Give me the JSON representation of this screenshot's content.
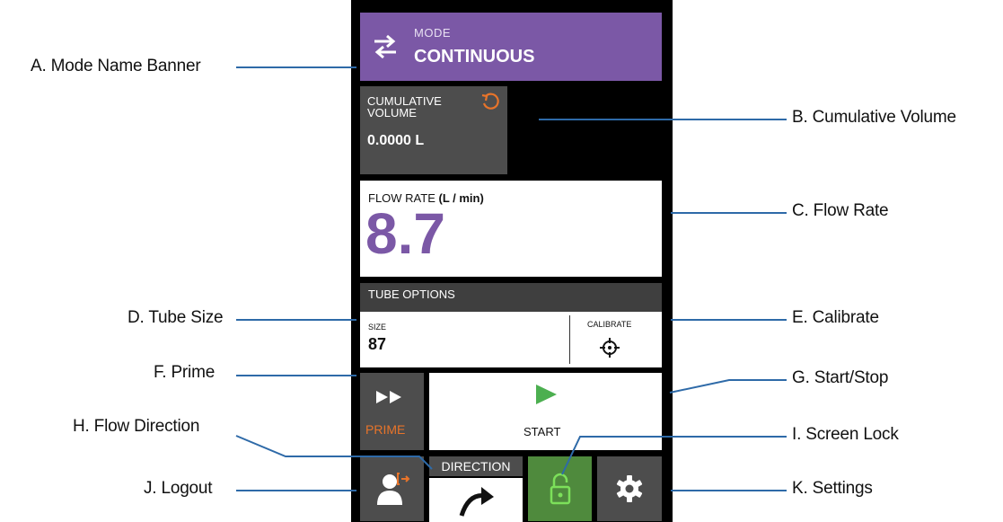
{
  "mode": {
    "label": "MODE",
    "value": "CONTINUOUS",
    "icon": "swap-arrows-icon",
    "color": "#7b58a6"
  },
  "cumulative": {
    "label": "CUMULATIVE VOLUME",
    "value": "0.0000 L",
    "icon": "reset-icon"
  },
  "flow": {
    "label": "FLOW RATE",
    "unit": "(L / min)",
    "value": "8.7"
  },
  "tube": {
    "header": "TUBE OPTIONS",
    "size_label": "SIZE",
    "size_value": "87",
    "calibrate_label": "CALIBRATE",
    "calibrate_icon": "crosshair-icon"
  },
  "prime": {
    "label": "PRIME",
    "icon": "fast-forward-icon"
  },
  "start": {
    "label": "START",
    "icon": "play-icon"
  },
  "direction": {
    "label": "DIRECTION",
    "icon": "clockwise-arrow-icon"
  },
  "footer": {
    "logout_icon": "logout-icon",
    "lock_icon": "unlock-icon",
    "settings_icon": "gear-icon"
  },
  "callouts": {
    "a": "A. Mode Name Banner",
    "b": "B. Cumulative Volume",
    "c": "C. Flow Rate",
    "d": "D. Tube Size",
    "e": "E. Calibrate",
    "f": "F. Prime",
    "g": "G. Start/Stop",
    "h": "H. Flow Direction",
    "i": "I. Screen Lock",
    "j": "J. Logout",
    "k": "K. Settings"
  }
}
